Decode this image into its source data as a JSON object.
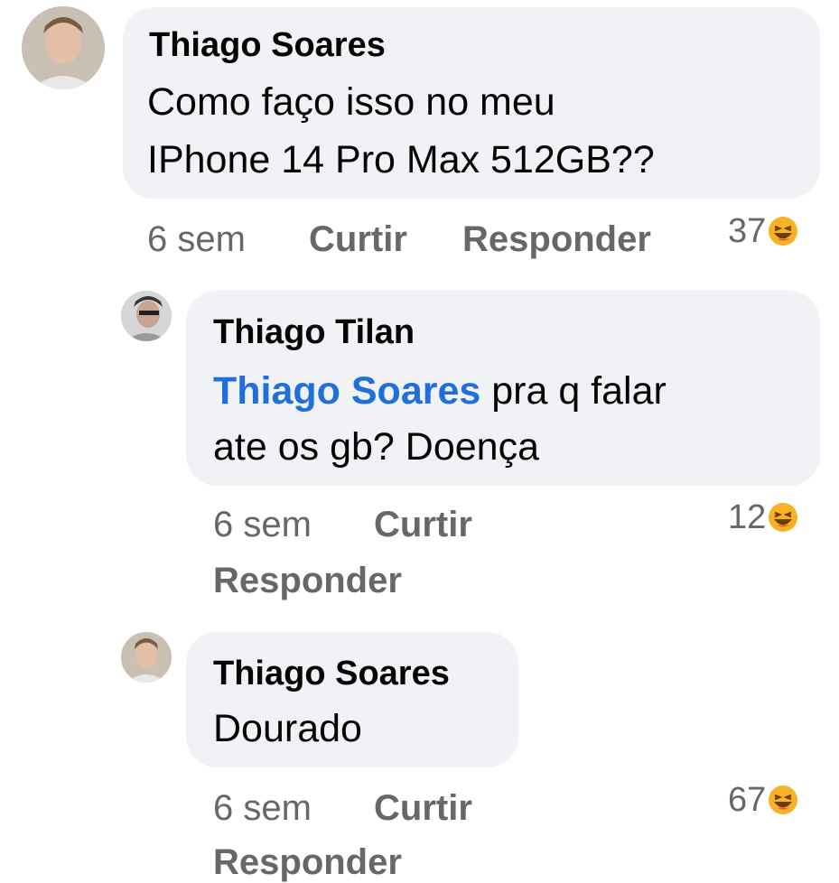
{
  "comments": [
    {
      "author": "Thiago Soares",
      "text_line1": "Como faço isso no meu",
      "text_line2": "IPhone 14 Pro Max 512GB??",
      "time": "6 sem",
      "like_label": "Curtir",
      "reply_label": "Responder",
      "reaction_count": "37",
      "reaction_icon": "laughing-emoji-icon"
    },
    {
      "author": "Thiago Tilan",
      "mention": "Thiago Soares",
      "text_line1_rest": " pra q falar",
      "text_line2": "ate os gb? Doença",
      "time": "6 sem",
      "like_label": "Curtir",
      "reply_label": "Responder",
      "reaction_count": "12",
      "reaction_icon": "laughing-emoji-icon"
    },
    {
      "author": "Thiago Soares",
      "text_line1": "Dourado",
      "time": "6 sem",
      "like_label": "Curtir",
      "reply_label": "Responder",
      "reaction_count": "67",
      "reaction_icon": "laughing-emoji-icon"
    }
  ],
  "colors": {
    "bubble": "#f0f2f5",
    "mention": "#216fdb",
    "meta": "#65676b",
    "text": "#050505"
  }
}
